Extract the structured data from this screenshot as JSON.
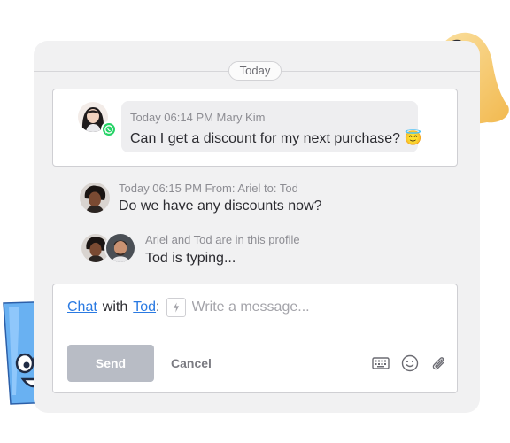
{
  "date_divider": "Today",
  "messages": [
    {
      "meta": "Today 06:14 PM Mary Kim",
      "text": "Can I get a discount for my next purchase?",
      "emoji": "😇",
      "channel": "whatsapp-icon"
    },
    {
      "meta": "Today  06:15 PM  From: Ariel to: Tod",
      "text": "Do we have any discounts now?"
    }
  ],
  "typing": {
    "meta": "Ariel and Tod are in this profile",
    "text": "Tod is typing..."
  },
  "composer": {
    "chat_link": "Chat",
    "with_text": "with",
    "recipient_link": "Tod",
    "colon": ":",
    "placeholder": "Write a message...",
    "send_label": "Send",
    "cancel_label": "Cancel"
  },
  "colors": {
    "link": "#2a7ae2",
    "send_button": "#b8bcc5",
    "whatsapp": "#25d366",
    "panel": "#f1f1f2"
  }
}
